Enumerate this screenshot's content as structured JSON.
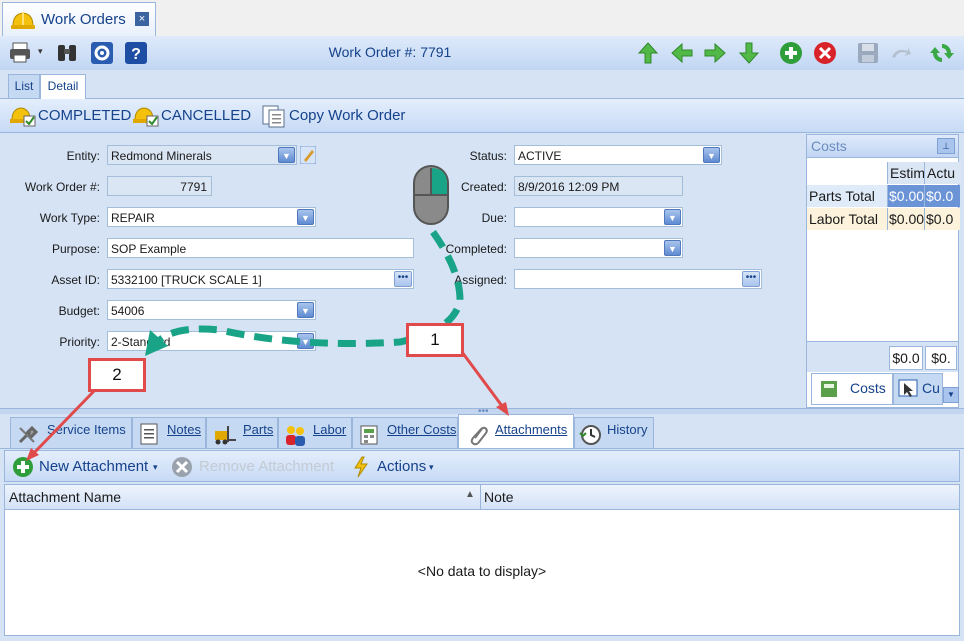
{
  "doc_tab": {
    "title": "Work Orders",
    "close": "×"
  },
  "toolbar": {
    "title": "Work Order #: 7791"
  },
  "view_tabs": [
    "List",
    "Detail"
  ],
  "status_actions": {
    "completed": "COMPLETED",
    "cancelled": "CANCELLED",
    "copy": "Copy Work Order"
  },
  "form": {
    "entity": {
      "label": "Entity:",
      "value": "Redmond Minerals"
    },
    "work_order": {
      "label": "Work Order #:",
      "value": "7791"
    },
    "work_type": {
      "label": "Work Type:",
      "value": "REPAIR"
    },
    "purpose": {
      "label": "Purpose:",
      "value": "SOP Example"
    },
    "asset": {
      "label": "Asset ID:",
      "value": "5332100 [TRUCK SCALE 1]"
    },
    "budget": {
      "label": "Budget:",
      "value": "54006"
    },
    "priority": {
      "label": "Priority:",
      "value": "2-Standard"
    },
    "status": {
      "label": "Status:",
      "value": "ACTIVE"
    },
    "created": {
      "label": "Created:",
      "value": "8/9/2016 12:09 PM"
    },
    "due": {
      "label": "Due:",
      "value": ""
    },
    "completed": {
      "label": "Completed:",
      "value": ""
    },
    "assigned": {
      "label": "Assigned:",
      "value": ""
    }
  },
  "costs": {
    "title": "Costs",
    "columns": [
      "Estim",
      "Actu"
    ],
    "rows": [
      {
        "label": "Parts Total",
        "est": "$0.00",
        "act": "$0.0"
      },
      {
        "label": "Labor Total",
        "est": "$0.00",
        "act": "$0.0"
      }
    ],
    "totals": [
      "$0.0",
      "$0."
    ],
    "tab_costs": "Costs",
    "tab_other": "Cu"
  },
  "bottom_tabs": [
    "Service Items",
    "Notes",
    "Parts",
    "Labor",
    "Other Costs",
    "Attachments",
    "History"
  ],
  "attachments": {
    "new": "New Attachment",
    "remove": "Remove Attachment",
    "actions": "Actions",
    "columns": [
      "Attachment Name",
      "Note"
    ],
    "empty": "<No data to display>"
  },
  "callouts": [
    "1",
    "2"
  ],
  "colors": {
    "accent": "#15428b",
    "callout": "#e04a4a",
    "dash": "#1aa487"
  }
}
